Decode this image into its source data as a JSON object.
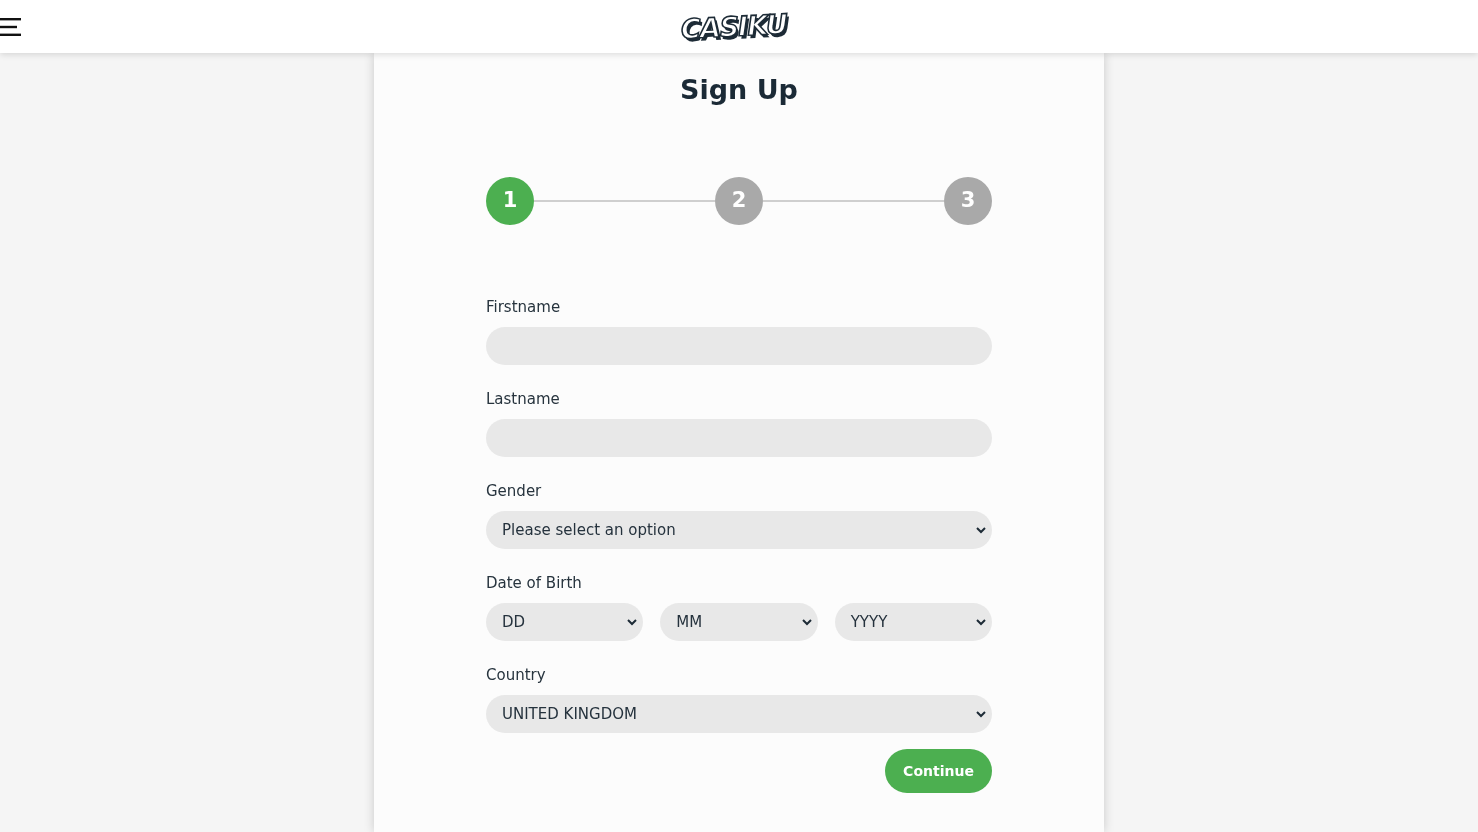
{
  "header": {
    "logo": "CASIKU"
  },
  "title": "Sign Up",
  "steps": [
    {
      "label": "1",
      "selected": true
    },
    {
      "label": "2",
      "selected": false
    },
    {
      "label": "3",
      "selected": false
    }
  ],
  "fields": [
    {
      "kind": "text",
      "label": "Firstname"
    },
    {
      "kind": "text",
      "label": "Lastname"
    },
    {
      "kind": "select",
      "label": "Gender",
      "value": "Please select an option"
    },
    {
      "kind": "select_group",
      "label": "Date of Birth",
      "selects": [
        {
          "value": "DD"
        },
        {
          "value": "MM"
        },
        {
          "value": "YYYY"
        }
      ]
    },
    {
      "kind": "select",
      "label": "Country",
      "value": "UNITED KINGDOM"
    }
  ],
  "continue_button": {
    "label": "Continue"
  }
}
